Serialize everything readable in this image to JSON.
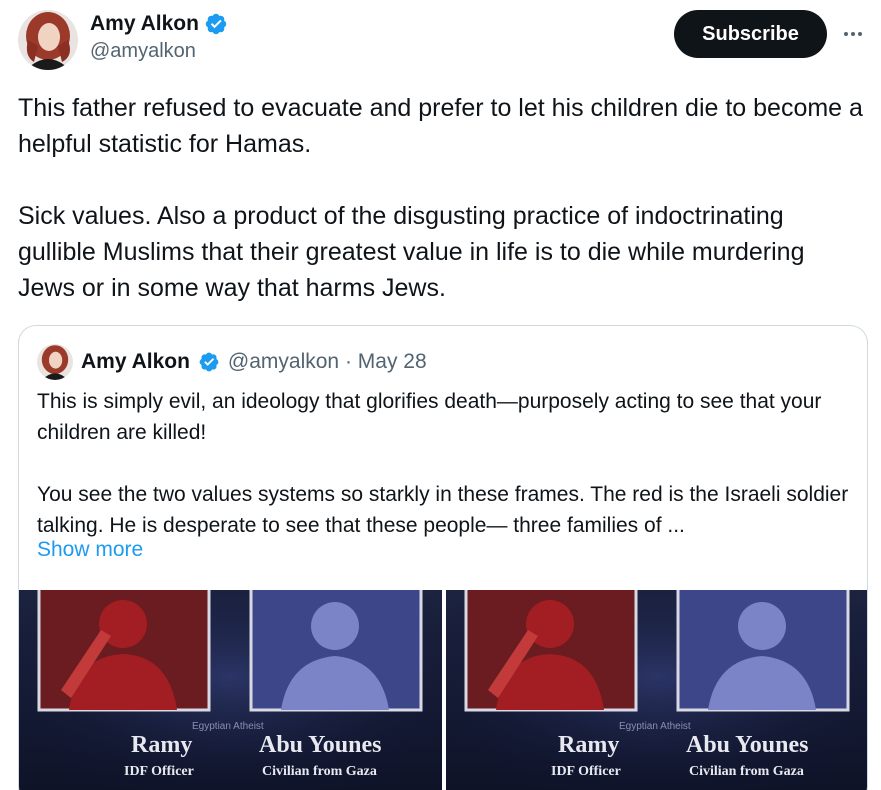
{
  "author": {
    "display_name": "Amy Alkon",
    "handle": "@amyalkon",
    "verified": true
  },
  "actions": {
    "subscribe_label": "Subscribe",
    "more_icon": "ellipsis-icon"
  },
  "tweet": {
    "text": "This father refused to evacuate and prefer to let his children die to become a helpful statistic for Hamas.\n\nSick values. Also a product of the disgusting practice of indoctrinating gullible Muslims that their greatest value in life is to die while murdering Jews or in some way that harms Jews."
  },
  "quote": {
    "display_name": "Amy Alkon",
    "meta": "@amyalkon · May 28",
    "text": "This is simply evil, an ideology that glorifies death—purposely acting to see that your children are killed!\n\nYou see the two values systems so starkly in these frames. The red is the Israeli soldier talking. He is desperate to see that these people— three families of ...",
    "show_more": "Show more"
  },
  "media": [
    {
      "watermark": "Egyptian Atheist",
      "left_name": "Ramy",
      "left_role": "IDF Officer",
      "right_name": "Abu Younes",
      "right_role": "Civilian from Gaza"
    },
    {
      "watermark": "Egyptian Atheist",
      "left_name": "Ramy",
      "left_role": "IDF Officer",
      "right_name": "Abu Younes",
      "right_role": "Civilian from Gaza"
    }
  ],
  "colors": {
    "accent": "#1d9bf0",
    "text": "#0f1419",
    "muted": "#536471",
    "border": "#cfd9de"
  }
}
